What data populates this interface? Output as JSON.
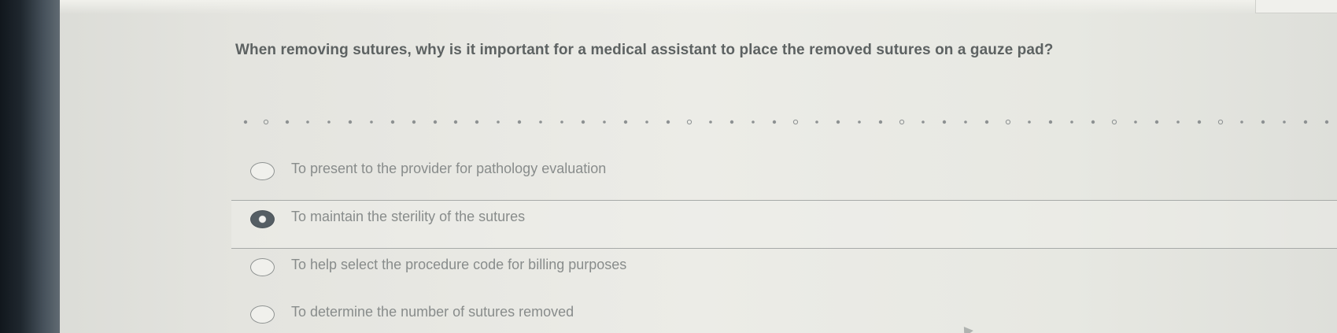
{
  "question": {
    "text": "When removing sutures, why is it important for a medical assistant to place the removed sutures on a gauze pad?"
  },
  "answers": [
    {
      "label": "To present to the provider for pathology evaluation",
      "selected": false
    },
    {
      "label": "To maintain the sterility of the sutures",
      "selected": true
    },
    {
      "label": "To help select the procedure code for billing purposes",
      "selected": false
    },
    {
      "label": "To determine the number of sutures removed",
      "selected": false
    }
  ],
  "colors": {
    "background": "#ecece7",
    "question_text": "#5d6262",
    "answer_text": "#888c8b",
    "selected_radio": "#555e64"
  }
}
